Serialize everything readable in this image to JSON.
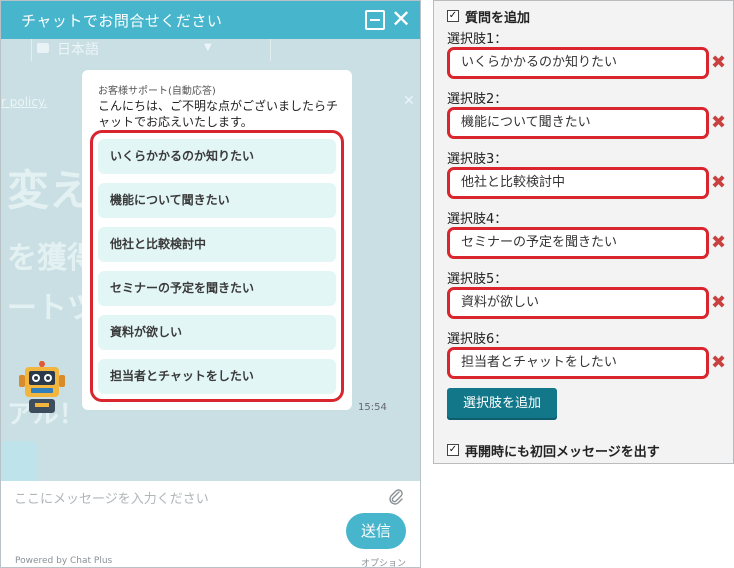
{
  "chat": {
    "title": "チャットでお問合せください",
    "close_glyph": "✕",
    "background": {
      "language": "日本語",
      "policy_text": "r policy.",
      "big1": "変え",
      "big2": "を獲得",
      "big3": "ートツ",
      "big4": "アル！"
    },
    "message": {
      "sender": "お客様サポート(自動応答)",
      "text": "こんにちは、ご不明な点がございましたらチャットでお応えいたします。",
      "options": [
        "いくらかかるのか知りたい",
        "機能について聞きたい",
        "他社と比較検討中",
        "セミナーの予定を聞きたい",
        "資料が欲しい",
        "担当者とチャットをしたい"
      ],
      "time": "15:54"
    },
    "input_placeholder": "ここにメッセージを入力ください",
    "send_label": "送信",
    "powered_by": "Powered by Chat Plus",
    "option_link": "オプション"
  },
  "settings": {
    "question_add_label": "質問を追加",
    "question_add_checked": "✓",
    "choices": [
      {
        "label": "選択肢1：",
        "value": "いくらかかるのか知りたい"
      },
      {
        "label": "選択肢2：",
        "value": "機能について聞きたい"
      },
      {
        "label": "選択肢3：",
        "value": "他社と比較検討中"
      },
      {
        "label": "選択肢4：",
        "value": "セミナーの予定を聞きたい"
      },
      {
        "label": "選択肢5：",
        "value": "資料が欲しい"
      },
      {
        "label": "選択肢6：",
        "value": "担当者とチャットをしたい"
      }
    ],
    "remove_glyph": "✖",
    "add_choice_label": "選択肢を追加",
    "reopen_label": "再開時にも初回メッセージを出す",
    "reopen_checked": "✓"
  },
  "colors": {
    "header_teal": "#47b5cb",
    "highlight_red": "#d9262e",
    "option_bg": "#e3f6f6",
    "add_button": "#13778a",
    "remove_x": "#c9413e"
  }
}
